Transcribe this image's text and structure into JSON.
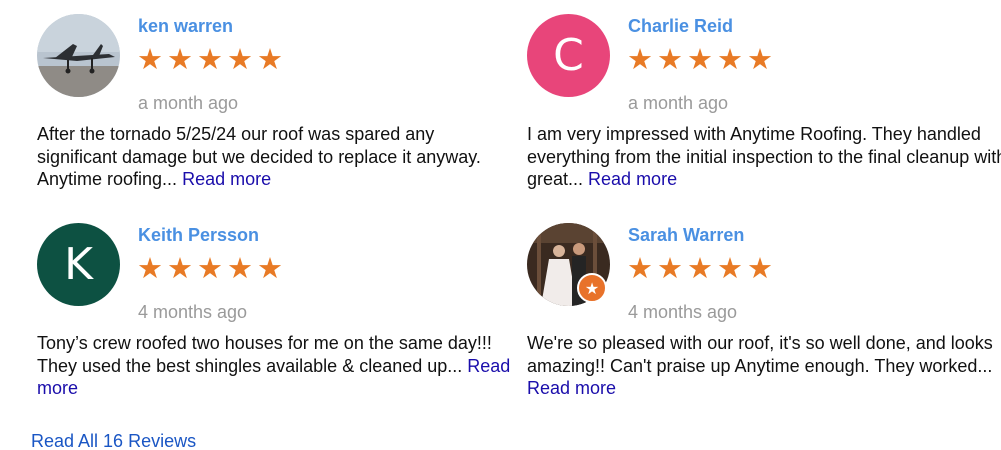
{
  "reviews": [
    {
      "name": "ken warren",
      "stars": 5,
      "date": "a month ago",
      "text": "After the tornado 5/25/24 our roof was spared any significant damage but we decided to replace it anyway. Anytime roofing... ",
      "read_more": "Read more",
      "avatar": {
        "type": "photo",
        "icon": "jet-photo"
      }
    },
    {
      "name": "Charlie Reid",
      "stars": 5,
      "date": "a month ago",
      "text": "I am very impressed with Anytime Roofing. They handled everything from the initial inspection to the final cleanup with great... ",
      "read_more": "Read more",
      "avatar": {
        "type": "letter",
        "letter": "C",
        "color": "#e8457a"
      }
    },
    {
      "name": "Keith Persson",
      "stars": 5,
      "date": "4 months ago",
      "text": "Tony’s crew roofed two houses for me on the same day!!! They used the best shingles available & cleaned up... ",
      "read_more": "Read more",
      "avatar": {
        "type": "letter",
        "letter": "K",
        "color": "#0d5142"
      }
    },
    {
      "name": "Sarah Warren",
      "stars": 5,
      "date": "4 months ago",
      "text": "We're so pleased with our roof, it's so well done, and looks amazing!! Can't praise up Anytime enough. They worked... ",
      "read_more": "Read more",
      "avatar": {
        "type": "photo",
        "icon": "wedding-photo",
        "badge": "local-guide-badge-icon"
      }
    }
  ],
  "star_glyph": "★",
  "footer": {
    "all_reviews_label": "Read All 16 Reviews"
  },
  "colors": {
    "name": "#4a90e2",
    "star": "#e87a25",
    "date": "#9a9a9a",
    "read_more": "#1a0dab",
    "footer_link": "#1a56c4"
  }
}
